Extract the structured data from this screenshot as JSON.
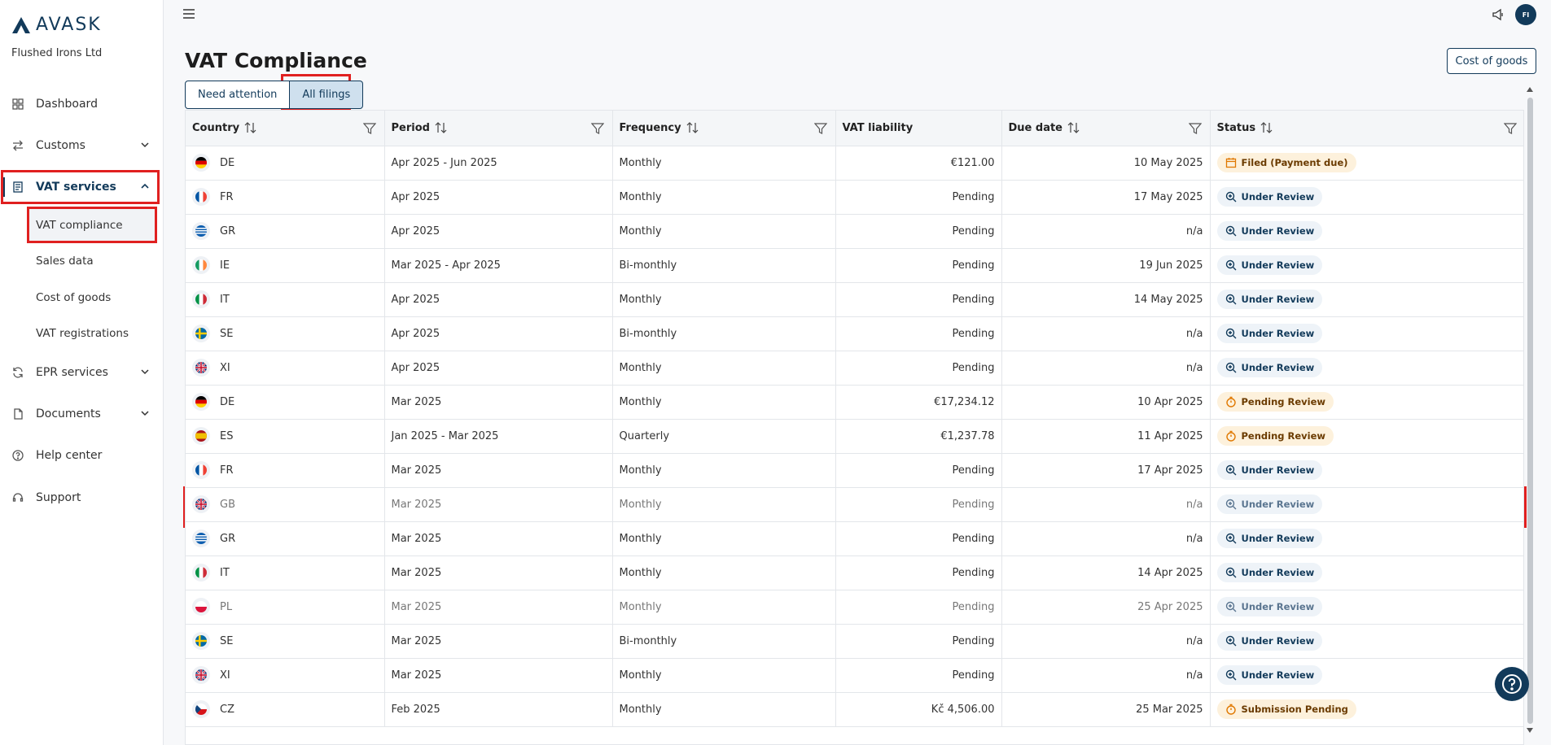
{
  "brand": {
    "name": "AVASK",
    "company": "Flushed Irons Ltd"
  },
  "nav": {
    "dashboard": "Dashboard",
    "customs": "Customs",
    "vat_services": "VAT services",
    "vat_compliance": "VAT compliance",
    "sales_data": "Sales data",
    "cost_of_goods": "Cost of goods",
    "vat_registrations": "VAT registrations",
    "epr_services": "EPR services",
    "documents": "Documents",
    "help_center": "Help center",
    "support": "Support"
  },
  "header": {
    "avatar_initials": "FI"
  },
  "page": {
    "title": "VAT Compliance",
    "cost_of_goods_button": "Cost of goods",
    "tabs": [
      "Need attention",
      "All filings"
    ]
  },
  "table": {
    "columns": [
      "Country",
      "Period",
      "Frequency",
      "VAT liability",
      "Due date",
      "Status"
    ],
    "rows": [
      {
        "country": "DE",
        "period": "Apr 2025 - Jun 2025",
        "frequency": "Monthly",
        "liability": "€121.00",
        "due": "10 May 2025",
        "status": "Filed (Payment due)",
        "kind": "filed"
      },
      {
        "country": "FR",
        "period": "Apr 2025",
        "frequency": "Monthly",
        "liability": "Pending",
        "due": "17 May 2025",
        "status": "Under Review",
        "kind": "review"
      },
      {
        "country": "GR",
        "period": "Apr 2025",
        "frequency": "Monthly",
        "liability": "Pending",
        "due": "n/a",
        "status": "Under Review",
        "kind": "review"
      },
      {
        "country": "IE",
        "period": "Mar 2025 - Apr 2025",
        "frequency": "Bi-monthly",
        "liability": "Pending",
        "due": "19 Jun 2025",
        "status": "Under Review",
        "kind": "review"
      },
      {
        "country": "IT",
        "period": "Apr 2025",
        "frequency": "Monthly",
        "liability": "Pending",
        "due": "14 May 2025",
        "status": "Under Review",
        "kind": "review"
      },
      {
        "country": "SE",
        "period": "Apr 2025",
        "frequency": "Bi-monthly",
        "liability": "Pending",
        "due": "n/a",
        "status": "Under Review",
        "kind": "review"
      },
      {
        "country": "XI",
        "period": "Apr 2025",
        "frequency": "Monthly",
        "liability": "Pending",
        "due": "n/a",
        "status": "Under Review",
        "kind": "review"
      },
      {
        "country": "DE",
        "period": "Mar 2025",
        "frequency": "Monthly",
        "liability": "€17,234.12",
        "due": "10 Apr 2025",
        "status": "Pending Review",
        "kind": "pending"
      },
      {
        "country": "ES",
        "period": "Jan 2025 - Mar 2025",
        "frequency": "Quarterly",
        "liability": "€1,237.78",
        "due": "11 Apr 2025",
        "status": "Pending Review",
        "kind": "pending"
      },
      {
        "country": "FR",
        "period": "Mar 2025",
        "frequency": "Monthly",
        "liability": "Pending",
        "due": "17 Apr 2025",
        "status": "Under Review",
        "kind": "review"
      },
      {
        "country": "GB",
        "period": "Mar 2025",
        "frequency": "Monthly",
        "liability": "Pending",
        "due": "n/a",
        "status": "Under Review",
        "kind": "review",
        "dim": true
      },
      {
        "country": "GR",
        "period": "Mar 2025",
        "frequency": "Monthly",
        "liability": "Pending",
        "due": "n/a",
        "status": "Under Review",
        "kind": "review"
      },
      {
        "country": "IT",
        "period": "Mar 2025",
        "frequency": "Monthly",
        "liability": "Pending",
        "due": "14 Apr 2025",
        "status": "Under Review",
        "kind": "review"
      },
      {
        "country": "PL",
        "period": "Mar 2025",
        "frequency": "Monthly",
        "liability": "Pending",
        "due": "25 Apr 2025",
        "status": "Under Review",
        "kind": "review",
        "dim": true
      },
      {
        "country": "SE",
        "period": "Mar 2025",
        "frequency": "Bi-monthly",
        "liability": "Pending",
        "due": "n/a",
        "status": "Under Review",
        "kind": "review"
      },
      {
        "country": "XI",
        "period": "Mar 2025",
        "frequency": "Monthly",
        "liability": "Pending",
        "due": "n/a",
        "status": "Under Review",
        "kind": "review"
      },
      {
        "country": "CZ",
        "period": "Feb 2025",
        "frequency": "Monthly",
        "liability": "Kč 4,506.00",
        "due": "25 Mar 2025",
        "status": "Submission Pending",
        "kind": "pending"
      }
    ]
  },
  "colors": {
    "brand": "#123a5a",
    "highlight": "#e02020",
    "pending_bg": "#fdf1dc",
    "review_bg": "#eef3f8"
  }
}
